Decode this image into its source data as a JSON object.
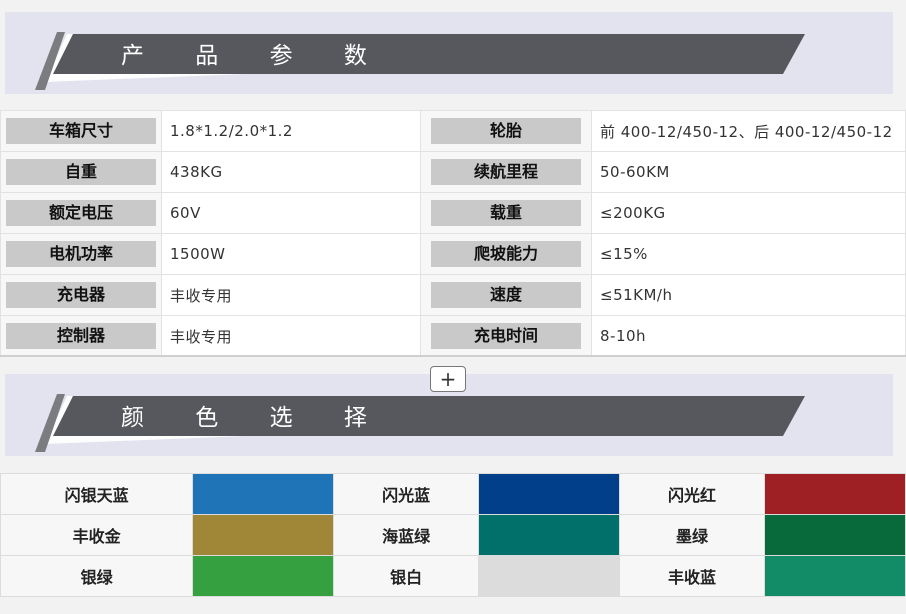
{
  "sections": {
    "params_title": "产 品 参 数",
    "colors_title": "颜 色 选 择",
    "expand_button": "+"
  },
  "params": [
    {
      "label1": "车箱尺寸",
      "value1": "1.8*1.2/2.0*1.2",
      "label2": "轮胎",
      "value2": "前 400-12/450-12、后 400-12/450-12"
    },
    {
      "label1": "自重",
      "value1": "438KG",
      "label2": "续航里程",
      "value2": "50-60KM"
    },
    {
      "label1": "额定电压",
      "value1": "60V",
      "label2": "载重",
      "value2": "≤200KG"
    },
    {
      "label1": "电机功率",
      "value1": "1500W",
      "label2": "爬坡能力",
      "value2": "≤15%"
    },
    {
      "label1": "充电器",
      "value1": "丰收专用",
      "label2": "速度",
      "value2": "≤51KM/h"
    },
    {
      "label1": "控制器",
      "value1": "丰收专用",
      "label2": "充电时间",
      "value2": "8-10h"
    }
  ],
  "colors": [
    [
      {
        "name": "闪银天蓝",
        "hex": "#1f73b7"
      },
      {
        "name": "闪光蓝",
        "hex": "#023f8a"
      },
      {
        "name": "闪光红",
        "hex": "#9e1f24"
      }
    ],
    [
      {
        "name": "丰收金",
        "hex": "#a08737"
      },
      {
        "name": "海蓝绿",
        "hex": "#01706a"
      },
      {
        "name": "墨绿",
        "hex": "#08693a"
      }
    ],
    [
      {
        "name": "银绿",
        "hex": "#34a03f"
      },
      {
        "name": "银白",
        "hex": "#dcdcdc"
      },
      {
        "name": "丰收蓝",
        "hex": "#128c67"
      }
    ]
  ]
}
